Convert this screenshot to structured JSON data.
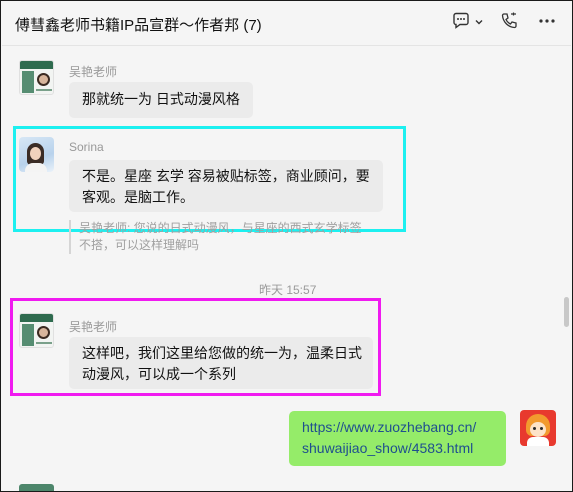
{
  "header": {
    "title": "傅彗鑫老师书籍IP品宣群～作者邦 (7)",
    "icons": [
      "chat-bubble-icon",
      "chevron-down-icon",
      "call-icon",
      "more-icon"
    ]
  },
  "messages": [
    {
      "sender": "吴艳老师",
      "text": "那就统一为 日式动漫风格",
      "avatar": "doc-avatar"
    },
    {
      "sender": "Sorina",
      "text_line1": "不是。星座 玄学 容易被贴标签，商业顾问，要",
      "text_line2": "客观。是脑工作。",
      "quote_line1": "吴艳老师: 您说的日式动漫风，与星座的西式玄学标签",
      "quote_line2": "不搭，可以这样理解吗",
      "avatar": "sorina-avatar"
    },
    {
      "timestamp": "昨天 15:57"
    },
    {
      "sender": "吴艳老师",
      "text_line1": "这样吧，我们这里给您做的统一为，温柔日式",
      "text_line2": "动漫风，可以成一个系列",
      "avatar": "doc-avatar"
    },
    {
      "mine": true,
      "link_line1": "https://www.zuozhebang.cn/",
      "link_line2": "shuwaijiao_show/4583.html",
      "avatar": "anime-avatar"
    }
  ],
  "colors": {
    "highlight_cyan": "#1df0f0",
    "highlight_magenta": "#f01af0",
    "my_bubble": "#95ec69",
    "other_bubble": "#ebebeb"
  }
}
